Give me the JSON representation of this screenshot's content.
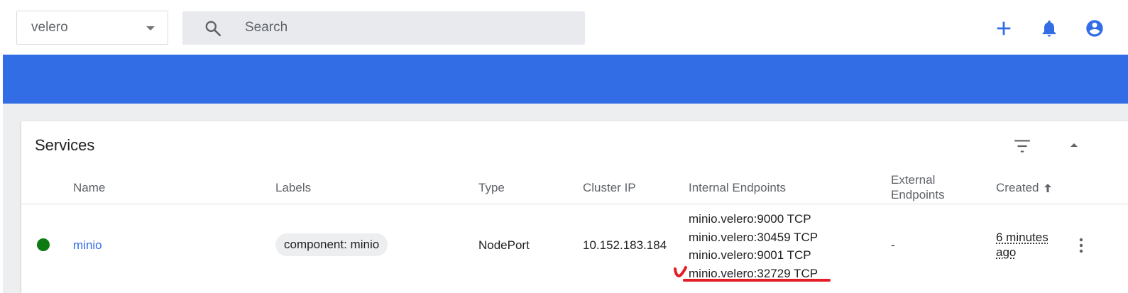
{
  "topbar": {
    "namespace": "velero",
    "search_placeholder": "Search",
    "icons": [
      "add-icon",
      "notifications-icon",
      "account-icon"
    ]
  },
  "colors": {
    "brand_blue": "#326de6",
    "status_running": "#0d7a12",
    "annotation_red": "#e41e26"
  },
  "services": {
    "title": "Services",
    "columns": {
      "name": "Name",
      "labels": "Labels",
      "type": "Type",
      "cluster_ip": "Cluster IP",
      "internal_endpoints": "Internal Endpoints",
      "external_endpoints_line1": "External",
      "external_endpoints_line2": "Endpoints",
      "created": "Created"
    },
    "rows": [
      {
        "status": "running",
        "name": "minio",
        "label": "component: minio",
        "type": "NodePort",
        "cluster_ip": "10.152.183.184",
        "internal_endpoints": [
          "minio.velero:9000 TCP",
          "minio.velero:30459 TCP",
          "minio.velero:9001 TCP",
          "minio.velero:32729 TCP"
        ],
        "external_endpoints": "-",
        "created_line1": "6 minutes",
        "created_line2": "ago"
      }
    ]
  }
}
